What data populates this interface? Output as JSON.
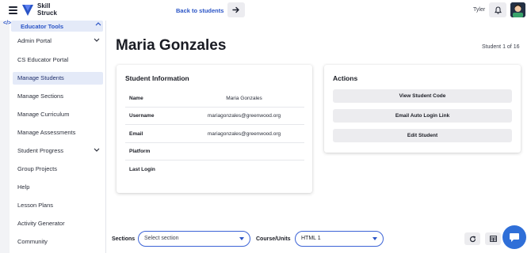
{
  "app": {
    "logo_line1": "Skill",
    "logo_line2": "Struck"
  },
  "header": {
    "back_label": "Back to students",
    "user_name": "Tyler"
  },
  "sidebar": {
    "section_label": "Educator Tools",
    "items": [
      {
        "label": "Admin Portal",
        "has_children": true
      },
      {
        "label": "CS Educator Portal"
      },
      {
        "label": "Manage Students",
        "active": true
      },
      {
        "label": "Manage Sections"
      },
      {
        "label": "Manage Curriculum"
      },
      {
        "label": "Manage Assessments"
      },
      {
        "label": "Student Progress",
        "has_children": true
      },
      {
        "label": "Group Projects"
      },
      {
        "label": "Help"
      },
      {
        "label": "Lesson Plans"
      },
      {
        "label": "Activity Generator"
      },
      {
        "label": "Community"
      }
    ]
  },
  "main": {
    "student_name": "Maria Gonzales",
    "student_position": "Student 1 of 16",
    "info_card": {
      "title": "Student Information",
      "rows": [
        {
          "label": "Name",
          "value": "Maria Gonzales"
        },
        {
          "label": "Username",
          "value": "mariagonzales@greenwood.org"
        },
        {
          "label": "Email",
          "value": "mariagonzales@greenwood.org"
        },
        {
          "label": "Platform",
          "value": ""
        },
        {
          "label": "Last Login",
          "value": ""
        }
      ]
    },
    "actions_card": {
      "title": "Actions",
      "buttons": [
        "View Student Code",
        "Email Auto Login Link",
        "Edit Student"
      ]
    }
  },
  "filters": {
    "sections_label": "Sections",
    "sections_placeholder": "Select section",
    "course_label": "Course/Units",
    "course_value": "HTML 1"
  },
  "colors": {
    "accent": "#2a54c6",
    "chat": "#2f6fd8",
    "active_bg": "#e4eaf8"
  },
  "icons": [
    "menu-icon",
    "logo-icon",
    "arrow-right-icon",
    "bell-icon",
    "avatar",
    "code-icon",
    "chevron-up-icon",
    "chevron-down-icon",
    "refresh-icon",
    "table-icon",
    "chat-icon"
  ]
}
